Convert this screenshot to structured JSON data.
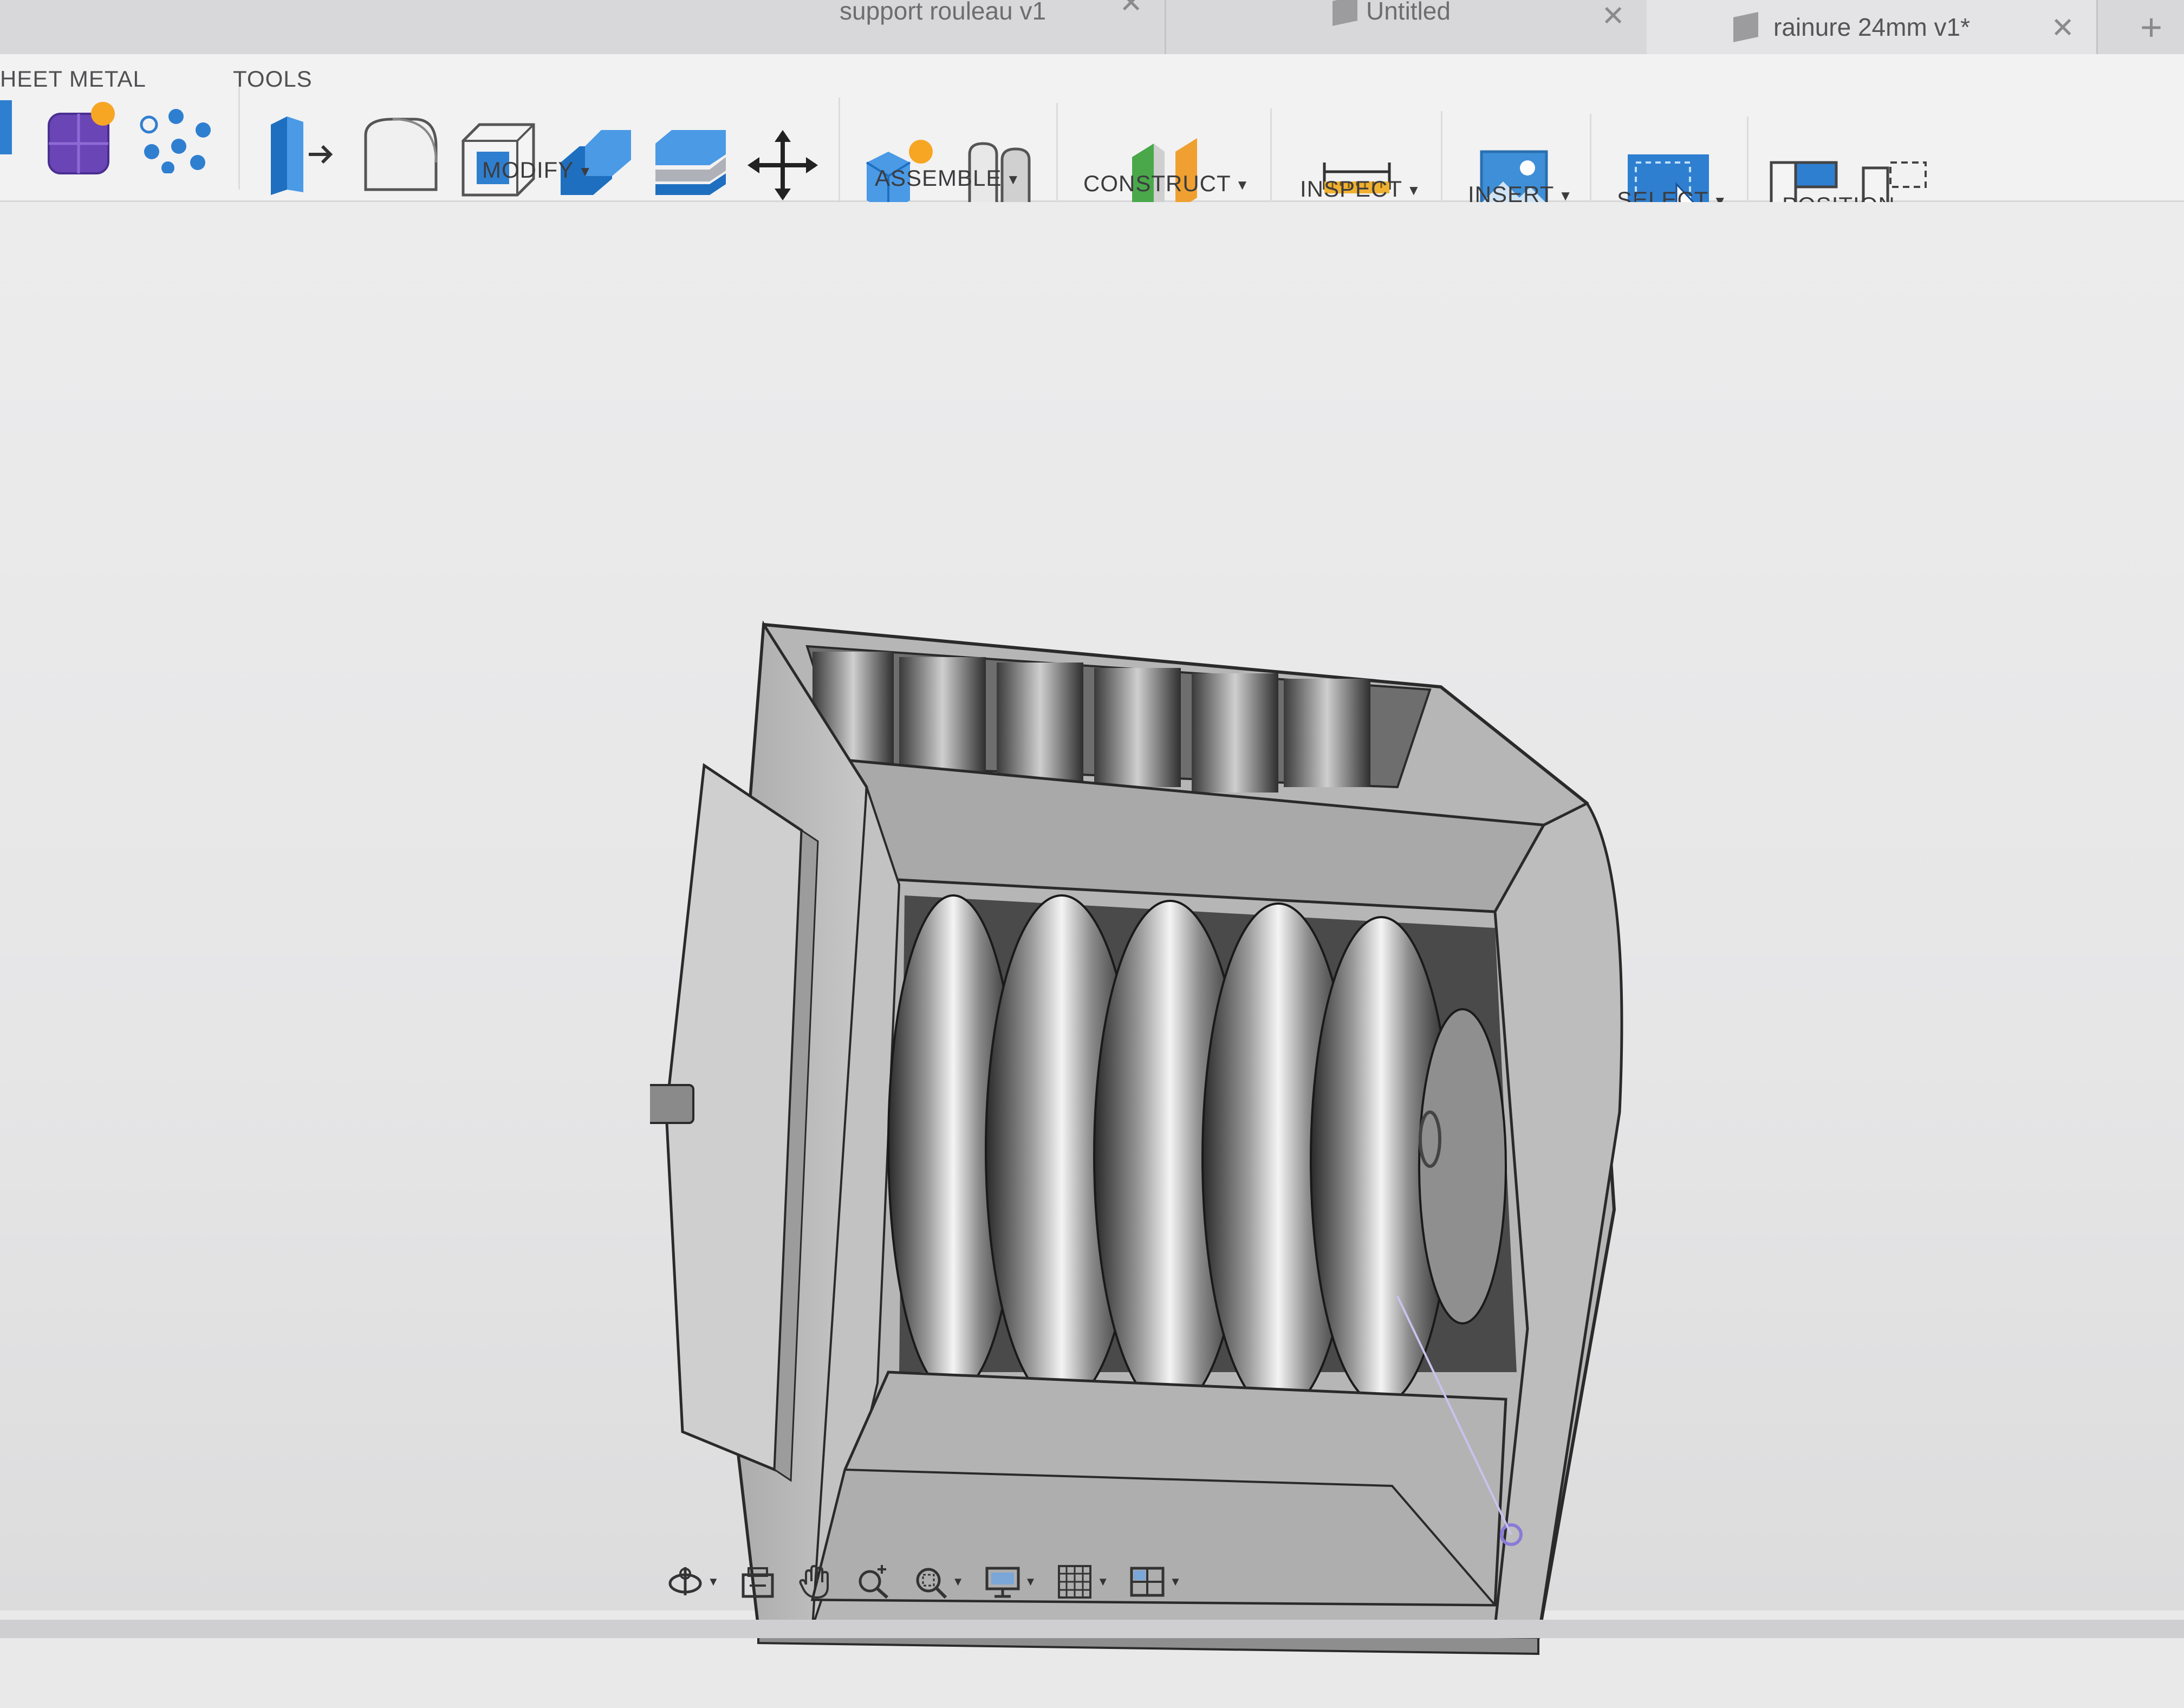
{
  "tabs": [
    {
      "label": "support rouleau v1",
      "active": false
    },
    {
      "label": "Untitled",
      "active": false
    },
    {
      "label": "rainure 24mm v1*",
      "active": true
    }
  ],
  "workspace_tabs": {
    "sheet_metal": "HEET METAL",
    "tools": "TOOLS"
  },
  "toolbar": {
    "modify_label": "MODIFY",
    "assemble_label": "ASSEMBLE",
    "construct_label": "CONSTRUCT",
    "inspect_label": "INSPECT",
    "insert_label": "INSERT",
    "select_label": "SELECT",
    "position_label": "POSITION"
  },
  "icons": {
    "create_form": "create-form-icon",
    "pattern": "pattern-icon",
    "press_pull": "press-pull-icon",
    "fillet": "fillet-icon",
    "shell": "shell-icon",
    "combine": "combine-icon",
    "split_body": "split-body-icon",
    "move": "move-icon",
    "new_component": "new-component-icon",
    "joint": "joint-icon",
    "offset_plane": "offset-plane-icon",
    "measure": "measure-icon",
    "insert_image": "insert-image-icon",
    "select": "select-icon",
    "capture_position": "capture-position-icon",
    "revert_position": "revert-position-icon"
  },
  "colors": {
    "accent_blue": "#2f7fd0",
    "toolbar_bg": "#f2f2f3",
    "viewport_bg": "#e9e9ea"
  },
  "navbar": {
    "items": [
      "orbit-icon",
      "look-at-icon",
      "pan-icon",
      "zoom-icon",
      "fit-icon",
      "display-settings-icon",
      "grid-icon",
      "viewports-icon"
    ]
  }
}
